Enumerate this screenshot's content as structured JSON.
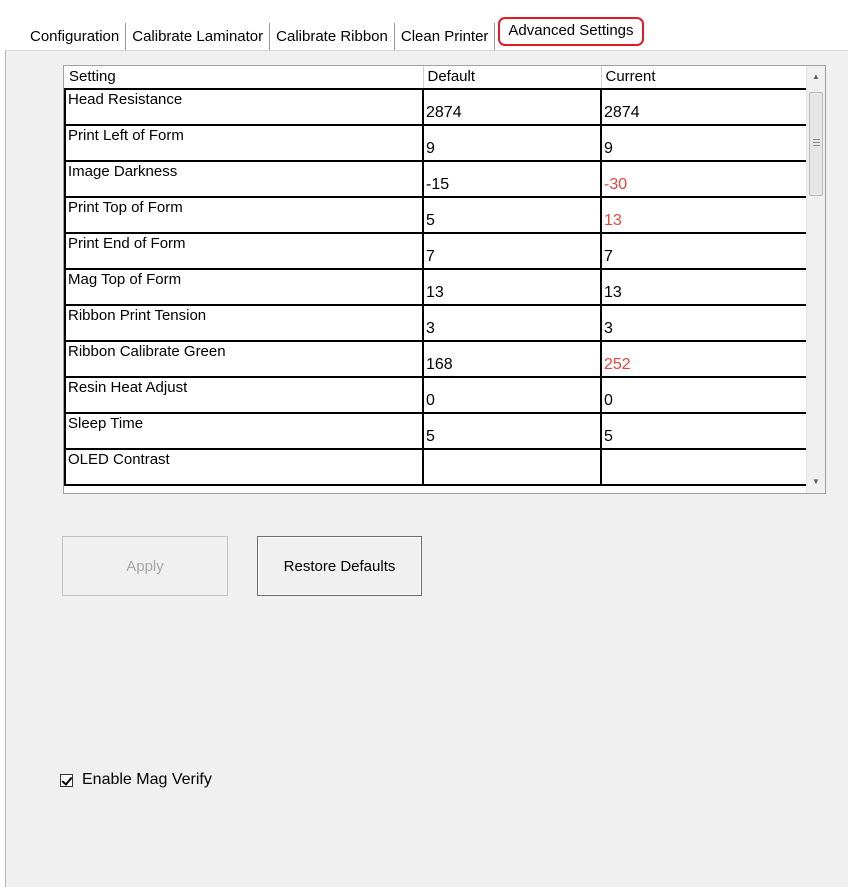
{
  "tabs": [
    {
      "label": "Configuration"
    },
    {
      "label": "Calibrate Laminator"
    },
    {
      "label": "Calibrate Ribbon"
    },
    {
      "label": "Clean Printer"
    },
    {
      "label": "Advanced Settings",
      "active": true
    }
  ],
  "grid": {
    "columns": [
      "Setting",
      "Default",
      "Current"
    ],
    "rows": [
      {
        "setting": "Head Resistance",
        "default": "2874",
        "current": "2874",
        "changed": false
      },
      {
        "setting": "Print Left of Form",
        "default": "9",
        "current": "9",
        "changed": false
      },
      {
        "setting": "Image Darkness",
        "default": "-15",
        "current": "-30",
        "changed": true
      },
      {
        "setting": "Print Top of Form",
        "default": "5",
        "current": "13",
        "changed": true
      },
      {
        "setting": "Print End of Form",
        "default": "7",
        "current": "7",
        "changed": false
      },
      {
        "setting": "Mag Top of Form",
        "default": "13",
        "current": "13",
        "changed": false
      },
      {
        "setting": "Ribbon Print Tension",
        "default": "3",
        "current": "3",
        "changed": false
      },
      {
        "setting": "Ribbon Calibrate Green",
        "default": "168",
        "current": "252",
        "changed": true
      },
      {
        "setting": "Resin Heat Adjust",
        "default": "0",
        "current": "0",
        "changed": false
      },
      {
        "setting": "Sleep Time",
        "default": "5",
        "current": "5",
        "changed": false
      },
      {
        "setting": "OLED Contrast",
        "default": "",
        "current": "",
        "changed": false
      }
    ]
  },
  "buttons": {
    "apply": "Apply",
    "restore": "Restore Defaults"
  },
  "checkbox": {
    "label": "Enable Mag Verify",
    "checked": true
  },
  "colors": {
    "changed_value": "#e8453c",
    "active_tab_outline": "#e11b22",
    "panel_bg": "#f0f0f0"
  }
}
